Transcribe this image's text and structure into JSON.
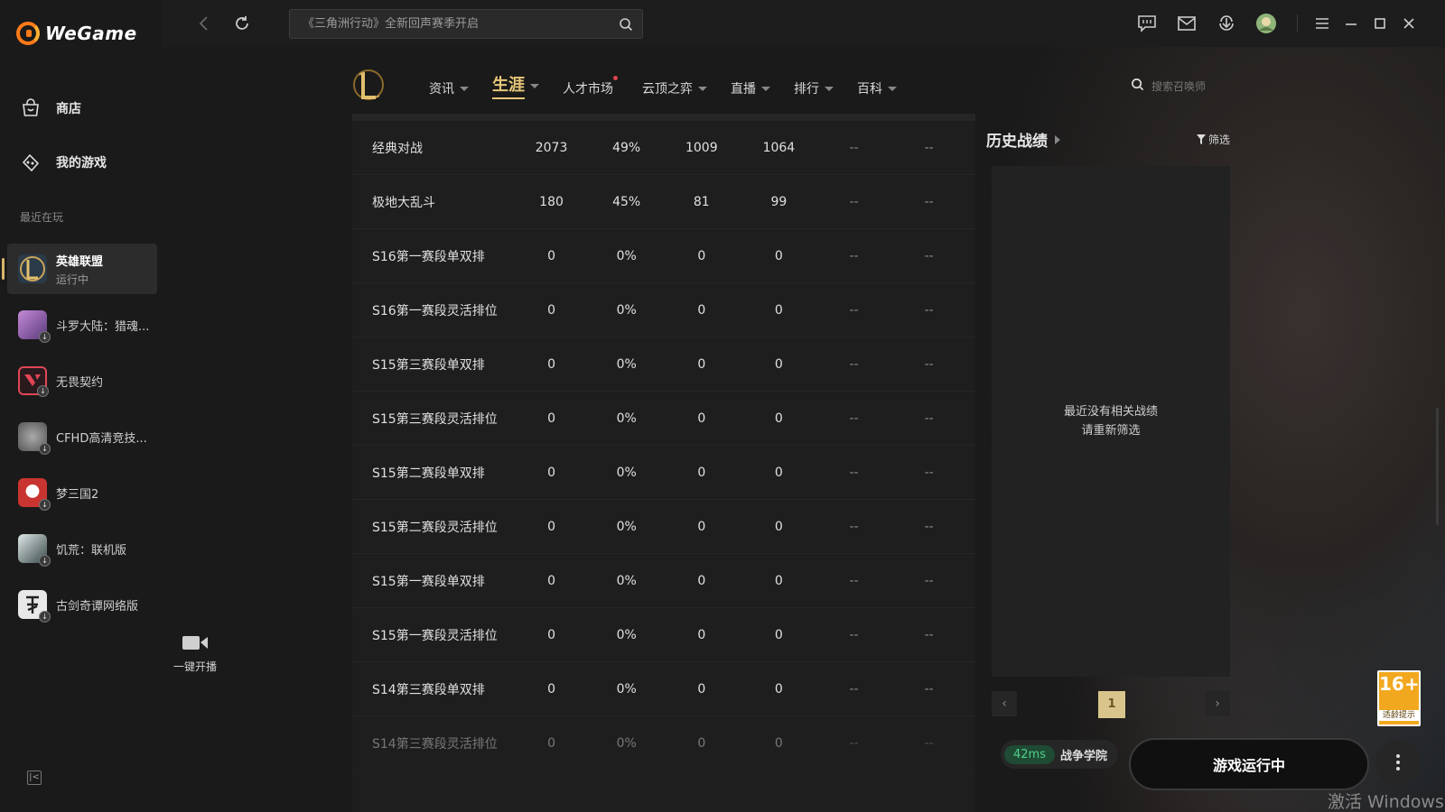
{
  "app": {
    "name": "WeGame"
  },
  "sidebar": {
    "nav": [
      {
        "label": "商店",
        "icon": "store-icon"
      },
      {
        "label": "我的游戏",
        "icon": "gamepad-icon"
      }
    ],
    "recent_title": "最近在玩",
    "games": [
      {
        "name": "英雄联盟",
        "sub": "运行中",
        "color": "#2a3a48"
      },
      {
        "name": "斗罗大陆：猎魂...",
        "color": "#6a4a8a"
      },
      {
        "name": "无畏契约",
        "color": "#e04655"
      },
      {
        "name": "CFHD高清竞技...",
        "color": "#7a7a7a"
      },
      {
        "name": "梦三国2",
        "color": "#c8342f"
      },
      {
        "name": "饥荒：联机版",
        "color": "#3a4a4a"
      },
      {
        "name": "古剑奇谭网络版",
        "color": "#d0d0d0"
      }
    ]
  },
  "topbar": {
    "search_placeholder": "《三角洲行动》全新回声赛季开启"
  },
  "lol": {
    "tabs": [
      {
        "label": "资讯",
        "caret": true
      },
      {
        "label": "生涯",
        "caret": true,
        "active": true
      },
      {
        "label": "人才市场",
        "dot": true
      },
      {
        "label": "云顶之弈",
        "caret": true
      },
      {
        "label": "直播",
        "caret": true
      },
      {
        "label": "排行",
        "caret": true
      },
      {
        "label": "百科",
        "caret": true
      }
    ],
    "summoner_search_placeholder": "搜索召唤师"
  },
  "stats_table": {
    "rows": [
      [
        "经典对战",
        "2073",
        "49%",
        "1009",
        "1064",
        "--",
        "--"
      ],
      [
        "极地大乱斗",
        "180",
        "45%",
        "81",
        "99",
        "--",
        "--"
      ],
      [
        "S16第一赛段单双排",
        "0",
        "0%",
        "0",
        "0",
        "--",
        "--"
      ],
      [
        "S16第一赛段灵活排位",
        "0",
        "0%",
        "0",
        "0",
        "--",
        "--"
      ],
      [
        "S15第三赛段单双排",
        "0",
        "0%",
        "0",
        "0",
        "--",
        "--"
      ],
      [
        "S15第三赛段灵活排位",
        "0",
        "0%",
        "0",
        "0",
        "--",
        "--"
      ],
      [
        "S15第二赛段单双排",
        "0",
        "0%",
        "0",
        "0",
        "--",
        "--"
      ],
      [
        "S15第二赛段灵活排位",
        "0",
        "0%",
        "0",
        "0",
        "--",
        "--"
      ],
      [
        "S15第一赛段单双排",
        "0",
        "0%",
        "0",
        "0",
        "--",
        "--"
      ],
      [
        "S15第一赛段灵活排位",
        "0",
        "0%",
        "0",
        "0",
        "--",
        "--"
      ],
      [
        "S14第三赛段单双排",
        "0",
        "0%",
        "0",
        "0",
        "--",
        "--"
      ],
      [
        "S14第三赛段灵活排位",
        "0",
        "0%",
        "0",
        "0",
        "--",
        "--"
      ]
    ]
  },
  "history": {
    "title": "历史战绩",
    "filter_label": "筛选",
    "empty_line1": "最近没有相关战绩",
    "empty_line2": "请重新筛选",
    "current_page": "1"
  },
  "bottom": {
    "ping": "42ms",
    "server": "战争学院",
    "play_label": "游戏运行中",
    "age_rating": "16+",
    "age_caption": "适龄提示",
    "stream_label": "一键开播",
    "watermark": "激活 Windows"
  }
}
